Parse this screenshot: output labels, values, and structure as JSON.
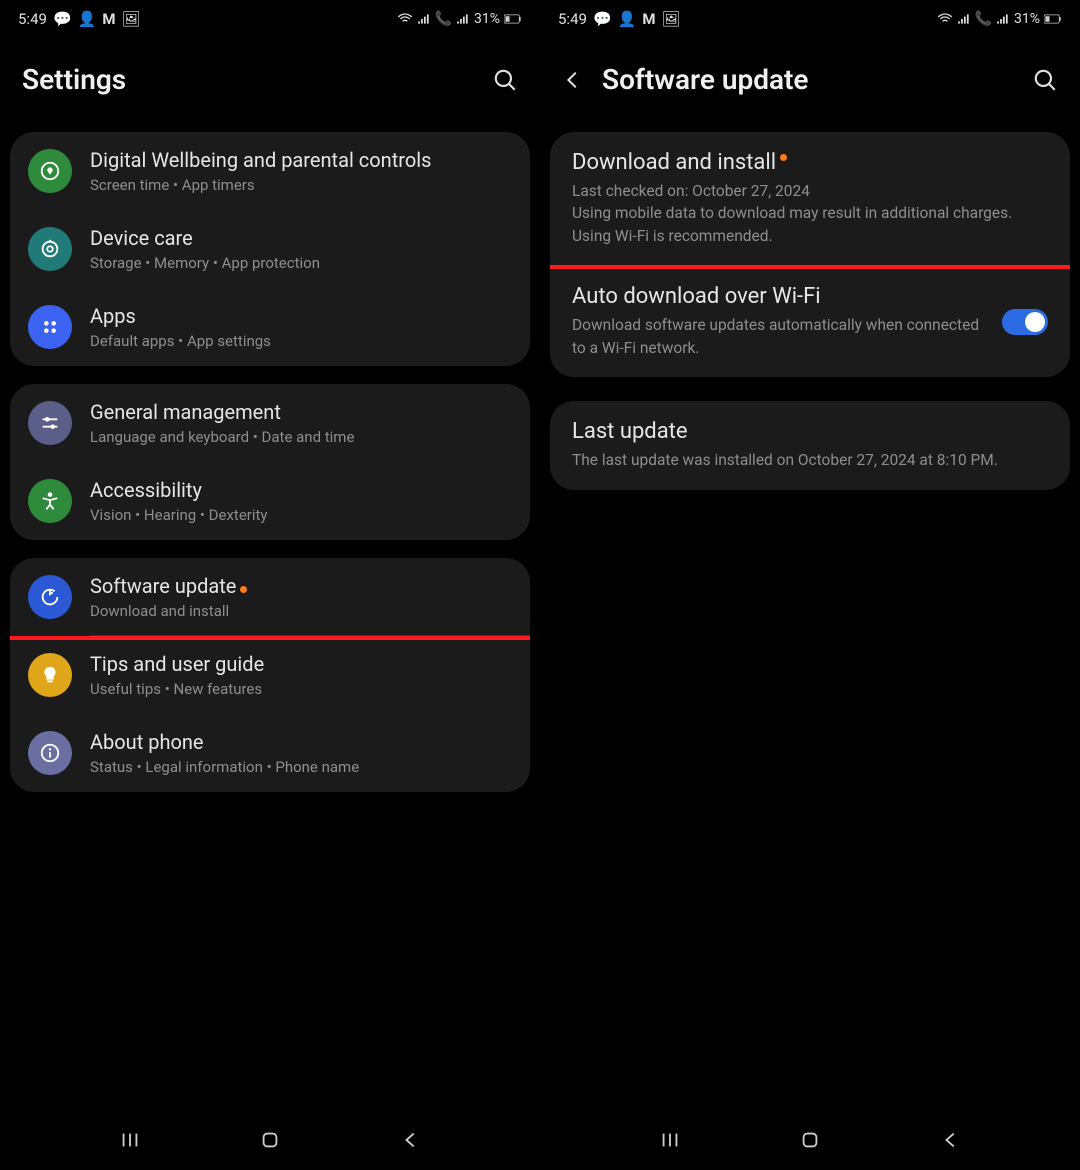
{
  "status": {
    "time": "5:49",
    "battery": "31%"
  },
  "left": {
    "title": "Settings",
    "groups": [
      {
        "items": [
          {
            "title": "Digital Wellbeing and parental controls",
            "sub": "Screen time  •  App timers",
            "icon": "wellbeing",
            "color": "#2f8b3c"
          },
          {
            "title": "Device care",
            "sub": "Storage  •  Memory  •  App protection",
            "icon": "device-care",
            "color": "#1f7a78"
          },
          {
            "title": "Apps",
            "sub": "Default apps  •  App settings",
            "icon": "apps",
            "color": "#3b62f0"
          }
        ]
      },
      {
        "items": [
          {
            "title": "General management",
            "sub": "Language and keyboard  •  Date and time",
            "icon": "sliders",
            "color": "#5b5e88"
          },
          {
            "title": "Accessibility",
            "sub": "Vision  •  Hearing  •  Dexterity",
            "icon": "accessibility",
            "color": "#2f8b3c"
          }
        ]
      },
      {
        "items": [
          {
            "title": "Software update",
            "sub": "Download and install",
            "icon": "update",
            "color": "#2b59d6",
            "highlight": true,
            "dot": true
          },
          {
            "title": "Tips and user guide",
            "sub": "Useful tips  •  New features",
            "icon": "bulb",
            "color": "#e0a61a"
          },
          {
            "title": "About phone",
            "sub": "Status  •  Legal information  •  Phone name",
            "icon": "info",
            "color": "#6b6ea0"
          }
        ]
      }
    ]
  },
  "right": {
    "title": "Software update",
    "items1": [
      {
        "title": "Download and install",
        "sub": "Last checked on: October 27, 2024\nUsing mobile data to download may result in additional charges. Using Wi-Fi is recommended.",
        "highlight": true,
        "dot": true
      },
      {
        "title": "Auto download over Wi-Fi",
        "sub": "Download software updates automatically when connected to a Wi-Fi network.",
        "toggle": true
      }
    ],
    "items2": [
      {
        "title": "Last update",
        "sub": "The last update was installed on October 27, 2024 at 8:10 PM."
      }
    ]
  }
}
